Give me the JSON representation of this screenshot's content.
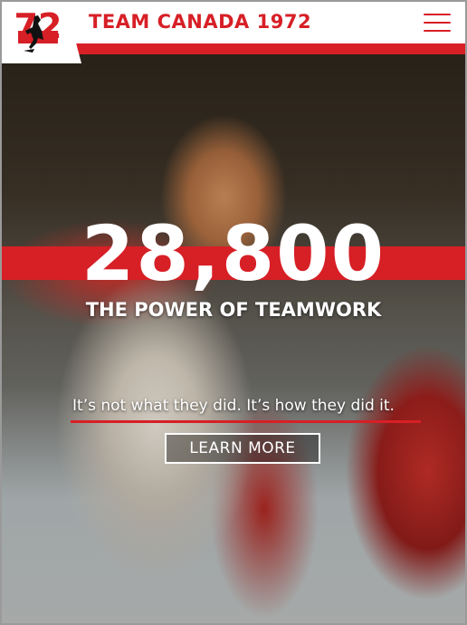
{
  "header": {
    "logo_text": "72",
    "title": "TEAM CANADA 1972",
    "menu_icon": "hamburger-menu-icon"
  },
  "hero": {
    "headline_number": "28,800",
    "subtitle": "THE POWER OF TEAMWORK",
    "tagline": "It’s not what they did. It’s how they did it.",
    "cta_label": "LEARN MORE"
  },
  "colors": {
    "brand_red": "#d71f26",
    "white": "#ffffff"
  }
}
